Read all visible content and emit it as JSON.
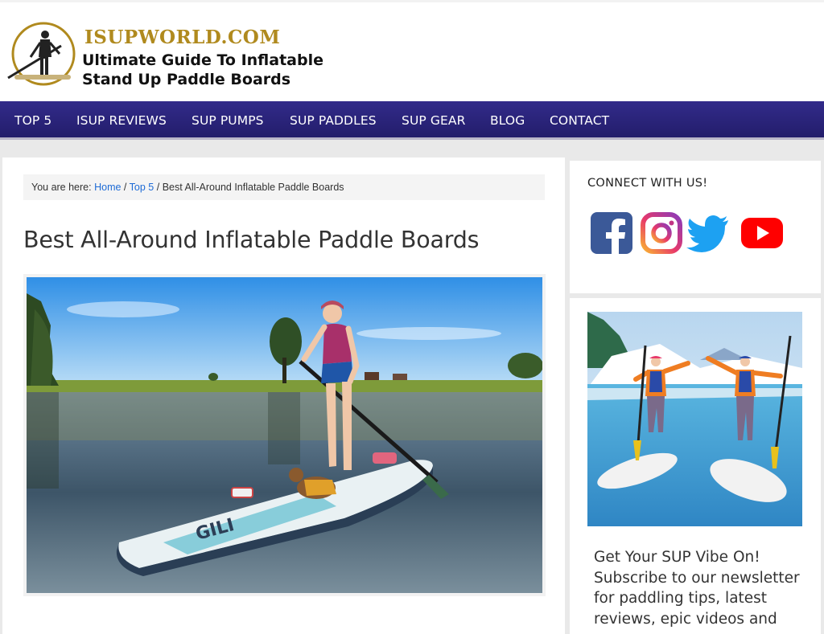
{
  "header": {
    "logo_title": "ISUPWORLD.COM",
    "logo_line1": "Ultimate Guide To Inflatable",
    "logo_line2": "Stand Up Paddle Boards"
  },
  "nav": {
    "items": [
      {
        "label": "TOP 5"
      },
      {
        "label": "ISUP REVIEWS"
      },
      {
        "label": "SUP PUMPS"
      },
      {
        "label": "SUP PADDLES"
      },
      {
        "label": "SUP GEAR"
      },
      {
        "label": "BLOG"
      },
      {
        "label": "CONTACT"
      }
    ]
  },
  "breadcrumb": {
    "prefix": "You are here:",
    "home": "Home",
    "sep1": "/",
    "parent": "Top 5",
    "sep2": "/",
    "current": "Best All-Around Inflatable Paddle Boards"
  },
  "main": {
    "title": "Best All-Around Inflatable Paddle Boards",
    "hero_board_brand": "GILI"
  },
  "sidebar": {
    "connect_title": "CONNECT WITH US!",
    "social_icons": [
      "facebook-icon",
      "instagram-icon",
      "twitter-icon",
      "youtube-icon"
    ],
    "newsletter_text": "Get Your SUP Vibe On! Subscribe to our newsletter for paddling tips, latest reviews, epic videos and"
  },
  "colors": {
    "nav_bg": "#2b2479",
    "logo_gold": "#b08a1e",
    "link_blue": "#1e6bd6",
    "facebook": "#3b5998",
    "twitter": "#1da1f2",
    "youtube": "#ff0000"
  }
}
